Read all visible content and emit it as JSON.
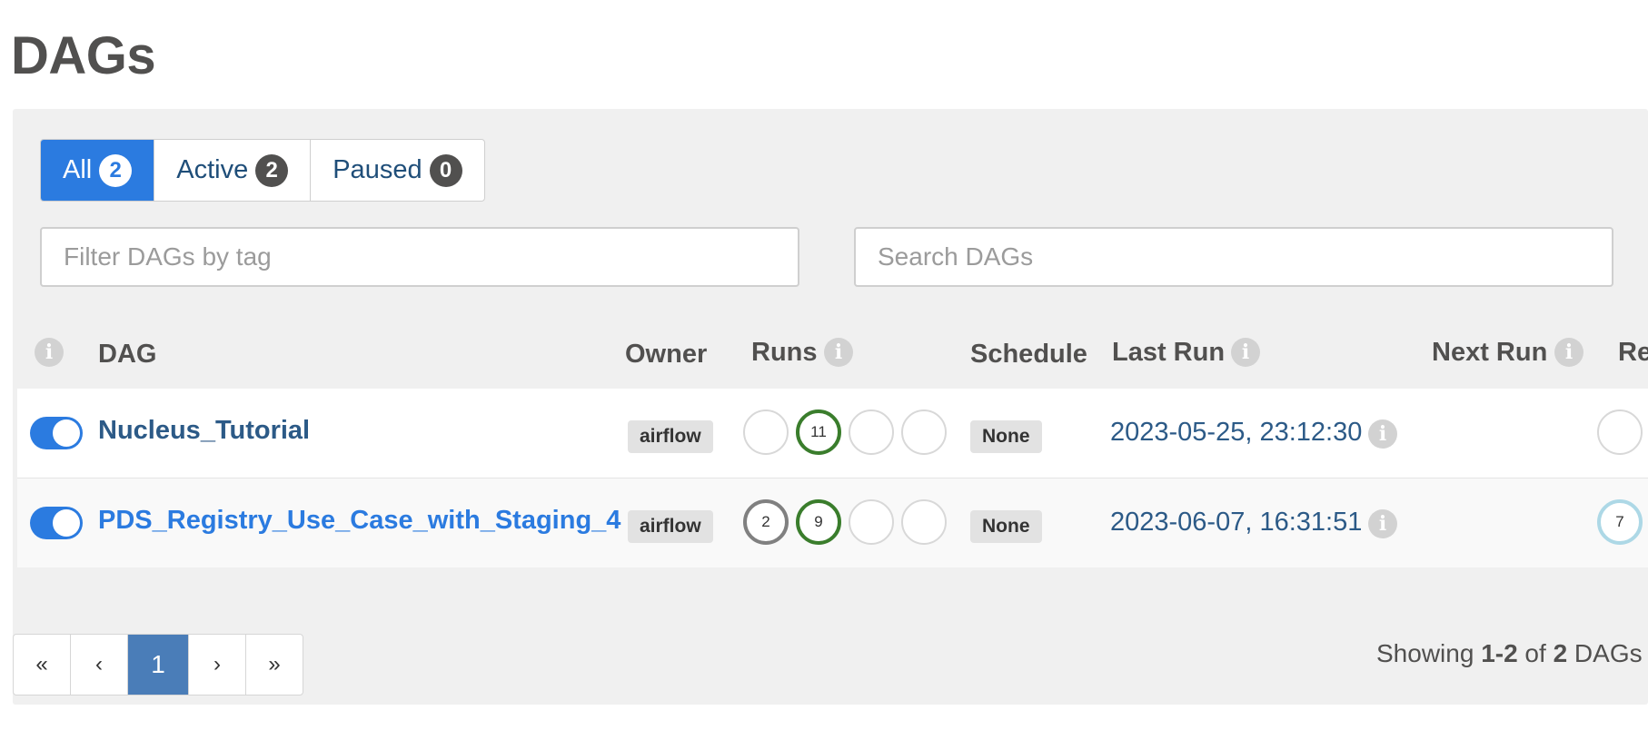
{
  "page": {
    "title": "DAGs"
  },
  "filters": {
    "all": {
      "label": "All",
      "count": "2"
    },
    "active": {
      "label": "Active",
      "count": "2"
    },
    "paused": {
      "label": "Paused",
      "count": "0"
    }
  },
  "tag_filter": {
    "placeholder": "Filter DAGs by tag",
    "value": ""
  },
  "search": {
    "placeholder": "Search DAGs",
    "value": ""
  },
  "table": {
    "headers": {
      "dag": "DAG",
      "owner": "Owner",
      "runs": "Runs",
      "schedule": "Schedule",
      "last_run": "Last Run",
      "next_run": "Next Run",
      "recent_tasks": "Re"
    },
    "info_icon_glyph": "i",
    "rows": [
      {
        "paused": false,
        "dag_id": "Nucleus_Tutorial",
        "owner": "airflow",
        "runs": {
          "queued": "",
          "success": "11",
          "running": "",
          "failed": ""
        },
        "schedule": "None",
        "last_run": "2023-05-25, 23:12:30",
        "next_run": "",
        "recent_tasks_first": ""
      },
      {
        "paused": false,
        "dag_id": "PDS_Registry_Use_Case_with_Staging_4",
        "owner": "airflow",
        "runs": {
          "queued": "2",
          "success": "9",
          "running": "",
          "failed": ""
        },
        "schedule": "None",
        "last_run": "2023-06-07, 16:31:51",
        "next_run": "",
        "recent_tasks_first": "7"
      }
    ]
  },
  "pagination": {
    "first": "«",
    "prev": "‹",
    "current": "1",
    "next": "›",
    "last": "»"
  },
  "showing": {
    "prefix": "Showing ",
    "range": "1-2",
    "of": " of ",
    "total": "2",
    "suffix": " DAGs"
  },
  "colors": {
    "accent": "#2b7be0",
    "success": "#3a7d2c",
    "queued": "#808080",
    "running": "#add8e6",
    "current_page": "#4a7db8"
  },
  "icons": [
    "info-icon",
    "toggle-switch"
  ]
}
